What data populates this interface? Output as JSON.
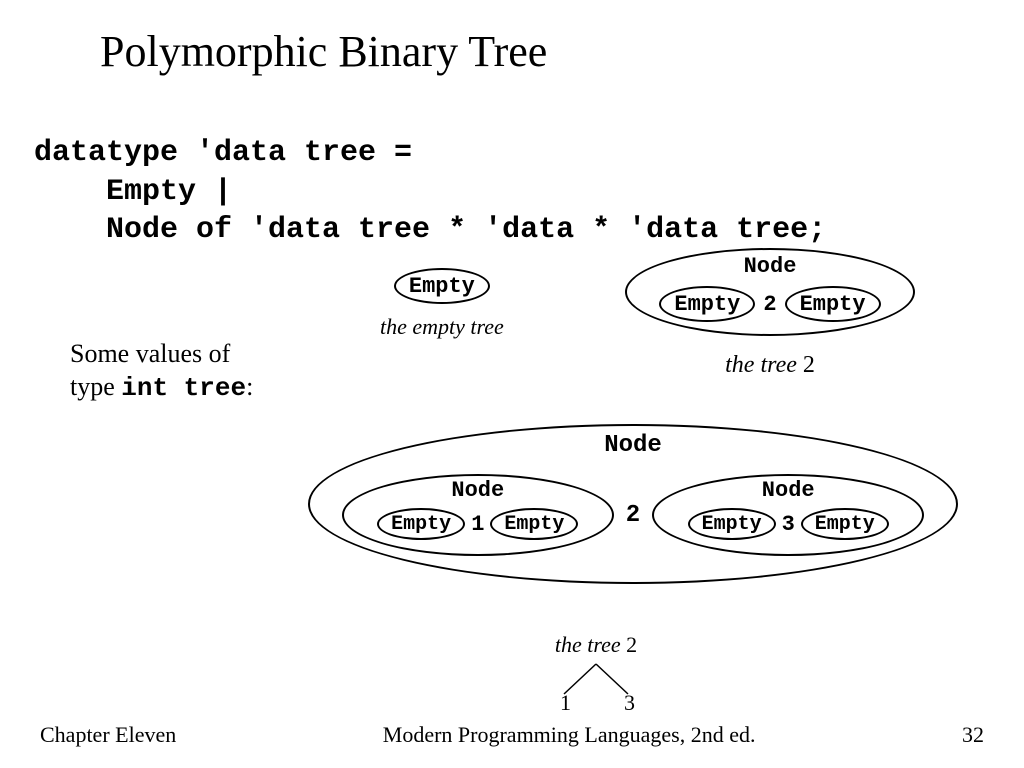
{
  "title": "Polymorphic Binary Tree",
  "code": {
    "line1": "datatype 'data tree =",
    "line2": "    Empty |",
    "line3": "    Node of 'data tree * 'data * 'data tree;"
  },
  "values_text": {
    "prefix": "Some values of\ntype ",
    "mono": "int tree",
    "suffix": ":"
  },
  "labels": {
    "node": "Node",
    "empty": "Empty"
  },
  "fig1": {
    "caption": "the empty tree"
  },
  "fig2": {
    "value": "2",
    "caption_prefix": "the tree ",
    "caption_value": "2"
  },
  "fig3": {
    "left_value": "1",
    "mid_value": "2",
    "right_value": "3"
  },
  "mini_tree": {
    "caption_prefix": "the tree ",
    "caption_value": "2",
    "left": "1",
    "right": "3"
  },
  "footer": {
    "left": "Chapter Eleven",
    "center": "Modern Programming Languages, 2nd ed.",
    "right": "32"
  }
}
